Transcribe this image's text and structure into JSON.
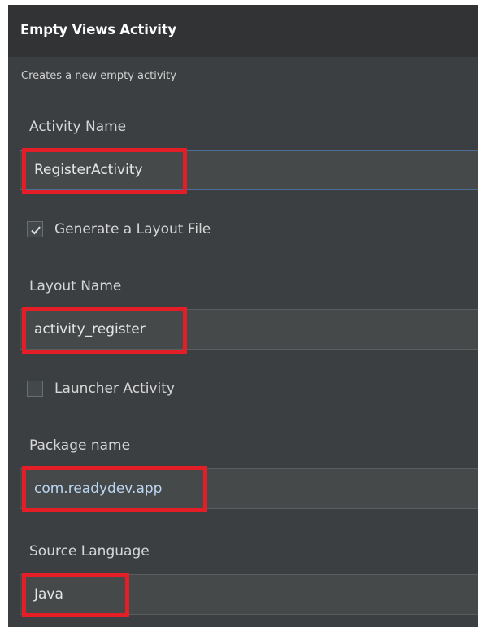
{
  "header": {
    "title": "Empty Views Activity",
    "subtitle": "Creates a new empty activity"
  },
  "form": {
    "activity_name": {
      "label": "Activity Name",
      "value": "RegisterActivity"
    },
    "generate_layout": {
      "label": "Generate a Layout File",
      "checked": true
    },
    "layout_name": {
      "label": "Layout Name",
      "value": "activity_register"
    },
    "launcher_activity": {
      "label": "Launcher Activity",
      "checked": false
    },
    "package_name": {
      "label": "Package name",
      "value": "com.readydev.app"
    },
    "source_language": {
      "label": "Source Language",
      "value": "Java"
    }
  },
  "colors": {
    "background": "#3c3f41",
    "header_bg": "#313335",
    "field_bg": "#45494a",
    "focus_border": "#4a6e96",
    "highlight": "#e41e26",
    "value_text_blue": "#bcd6f2"
  },
  "icons": {
    "checkmark": "checkmark-icon"
  }
}
